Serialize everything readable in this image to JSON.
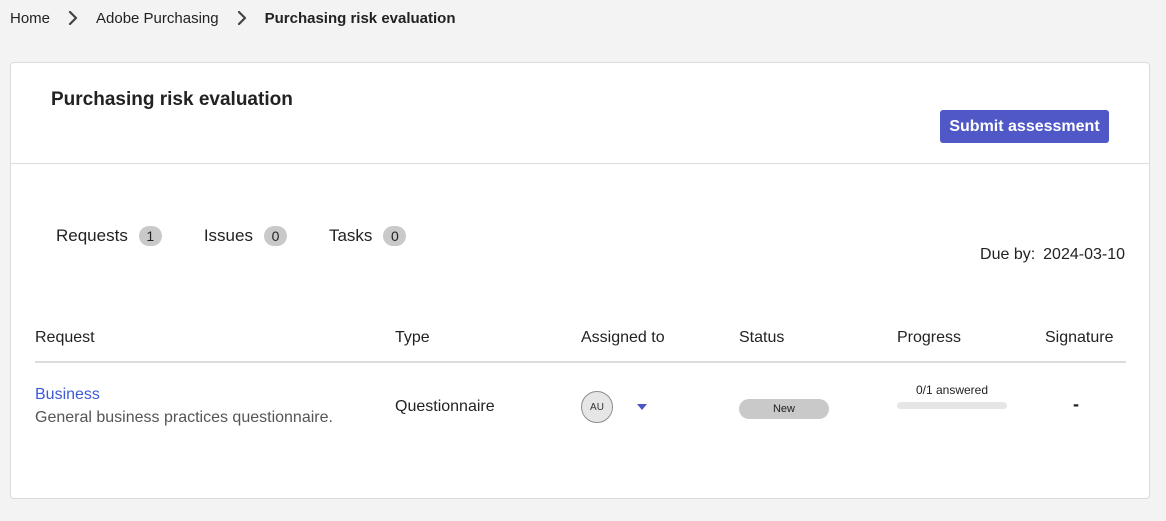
{
  "breadcrumb": {
    "items": [
      {
        "label": "Home"
      },
      {
        "label": "Adobe Purchasing"
      },
      {
        "label": "Purchasing risk evaluation"
      }
    ]
  },
  "header": {
    "title": "Purchasing risk evaluation",
    "submit_label": "Submit assessment"
  },
  "tabs": [
    {
      "label": "Requests",
      "count": "1"
    },
    {
      "label": "Issues",
      "count": "0"
    },
    {
      "label": "Tasks",
      "count": "0"
    }
  ],
  "due": {
    "label": "Due by:",
    "date": "2024-03-10"
  },
  "table": {
    "columns": [
      "Request",
      "Type",
      "Assigned to",
      "Status",
      "Progress",
      "Signature"
    ],
    "rows": [
      {
        "request_title": "Business",
        "request_description": "General business practices questionnaire.",
        "type": "Questionnaire",
        "assignee_initials": "AU",
        "status": "New",
        "progress_text": "0/1 answered",
        "progress_fraction": 0,
        "signature": "-"
      }
    ]
  },
  "icons": {
    "breadcrumb_separator": "chevron-right-icon",
    "assignee_dropdown": "caret-down-icon"
  },
  "colors": {
    "accent": "#5058c8",
    "link": "#3e5bd6",
    "badge_bg": "#c9c9c9",
    "page_bg": "#f3f3f3",
    "card_bg": "#ffffff"
  }
}
